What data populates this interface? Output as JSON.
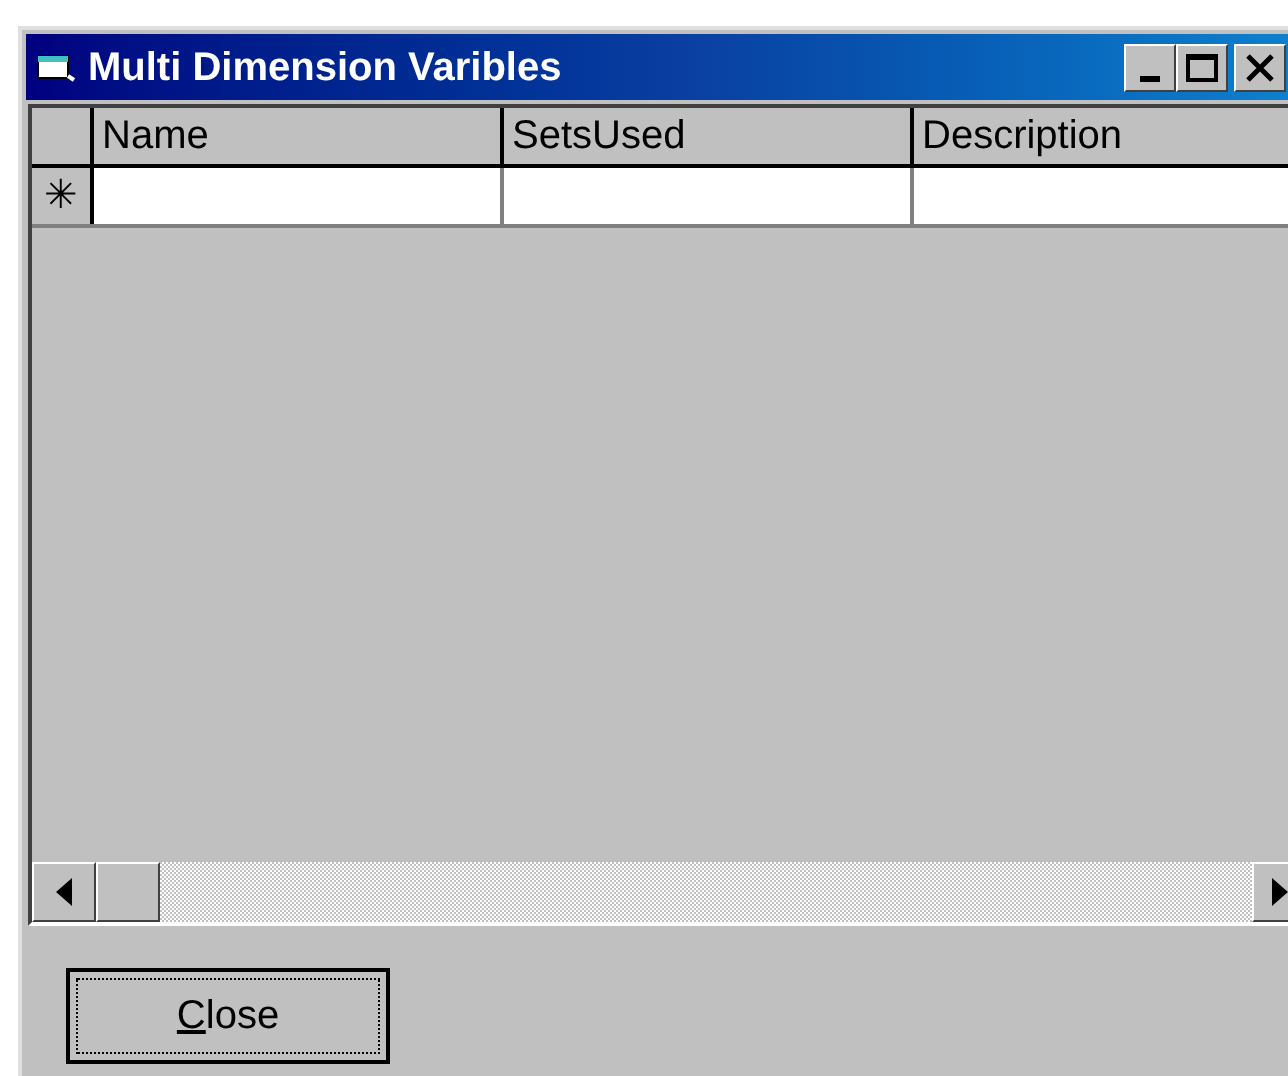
{
  "window": {
    "title": "Multi Dimension Varibles"
  },
  "table": {
    "columns": [
      "Name",
      "SetsUsed",
      "Description"
    ],
    "new_row_marker": "✳"
  },
  "buttons": [
    {
      "label": "Close"
    }
  ]
}
